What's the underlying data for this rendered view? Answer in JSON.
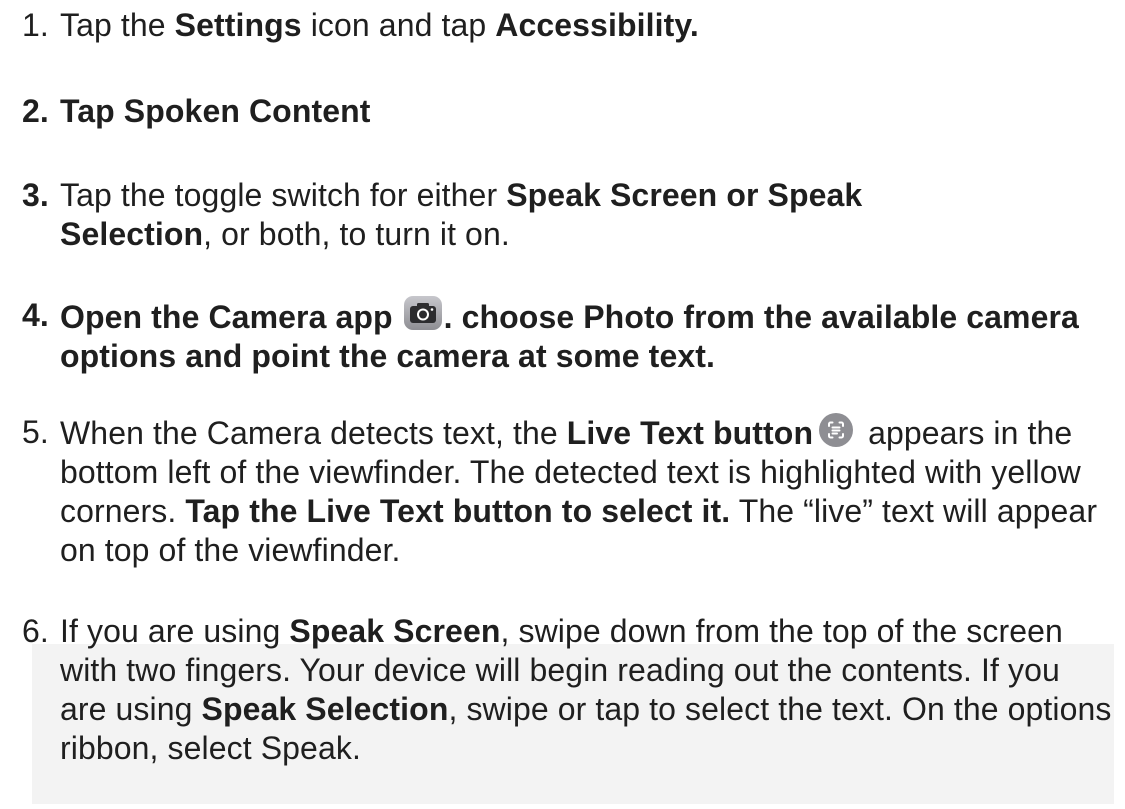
{
  "steps": [
    {
      "number": "1.",
      "parts": [
        "Tap the ",
        "Settings",
        " icon and tap ",
        "Accessibility."
      ]
    },
    {
      "number": "2.",
      "text": "Tap Spoken Content"
    },
    {
      "number": "3.",
      "parts": [
        "Tap the toggle switch for either ",
        "Speak Screen or Speak Selection",
        ", or both, to turn it on."
      ]
    },
    {
      "number": "4.",
      "parts": [
        "Open the Camera app ",
        ". choose Photo from the available camera options and point the camera at some text."
      ]
    },
    {
      "number": "5.",
      "parts": [
        "When the Camera detects text, the ",
        "Live Text button",
        " appears in the bottom left of the viewfinder. The detected text is highlighted with yellow corners. ",
        "Tap the Live Text button to select it.",
        " The “live” text will appear on top of the viewfinder."
      ]
    },
    {
      "number": "6.",
      "parts": [
        "If you are using ",
        "Speak Screen",
        ", swipe down from the top of the screen with two fingers. Your device will begin reading out the contents. If you are using ",
        "Speak Selection",
        ", swipe or tap to select the text. On the options ribbon, select Speak."
      ]
    }
  ],
  "icons": {
    "camera": "camera-app-icon",
    "live_text": "live-text-icon"
  },
  "colors": {
    "text": "#1f1f1f",
    "icon_gray": "#8e8e93",
    "panel_bg": "#f3f3f3"
  }
}
